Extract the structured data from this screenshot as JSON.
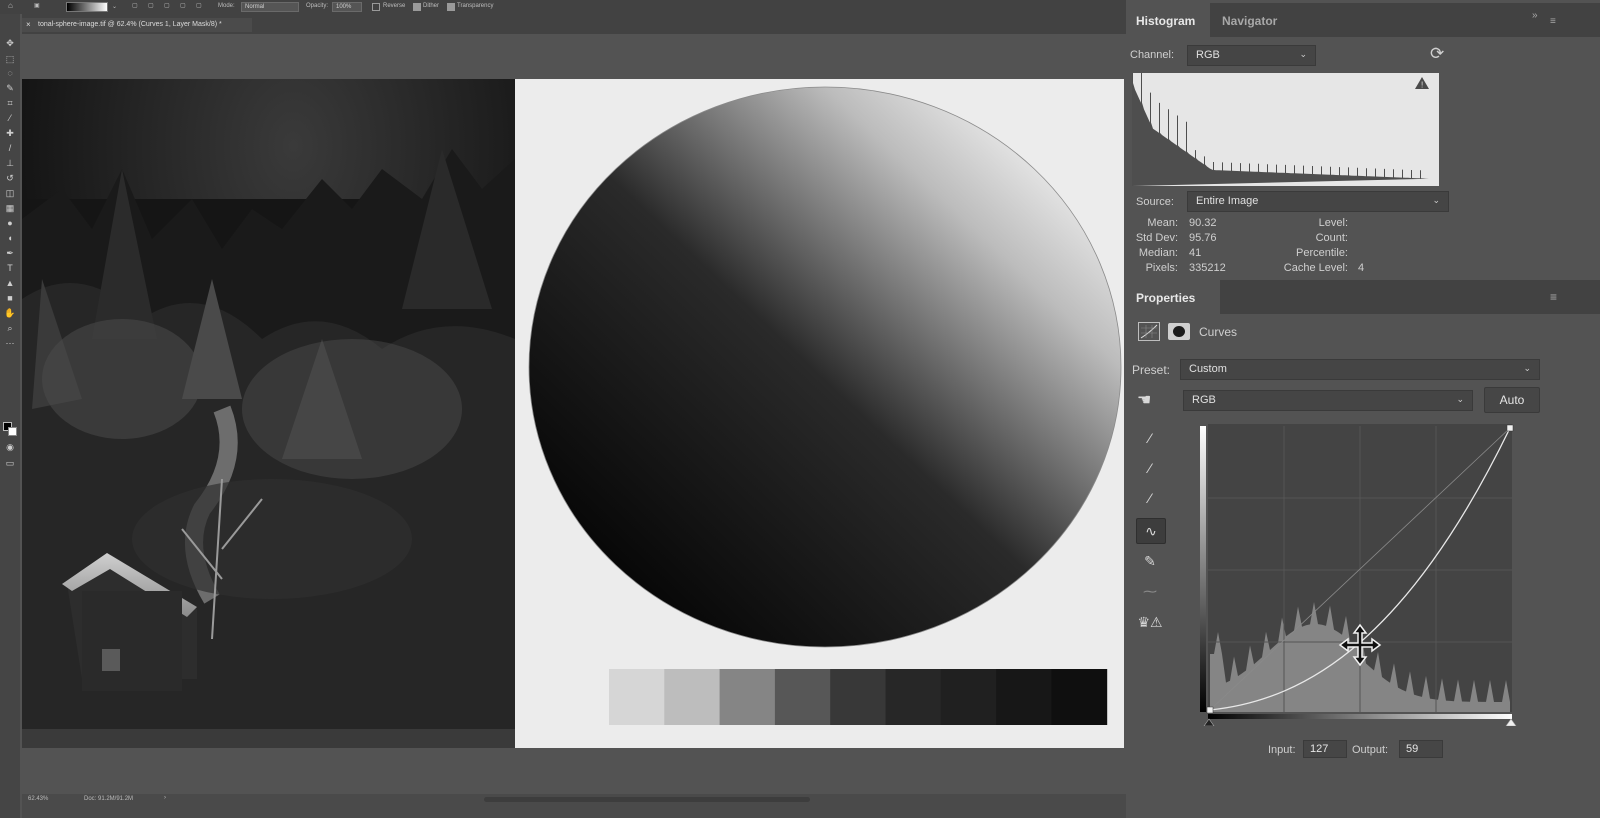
{
  "options_bar": {
    "mode_label": "Mode:",
    "mode_value": "Normal",
    "opacity_label": "Opacity:",
    "opacity_value": "100%",
    "reverse_label": "Reverse",
    "dither_label": "Dither",
    "transparency_label": "Transparency"
  },
  "document": {
    "tab_title": "tonal-sphere-image.tif @ 62.4% (Curves 1, Layer Mask/8) *"
  },
  "status_bar": {
    "zoom": "62.43%",
    "doc_size": "Doc: 91.2M/91.2M"
  },
  "canvas": {
    "tonal_steps": [
      "#d6d6d6",
      "#bdbdbd",
      "#858585",
      "#575757",
      "#383838",
      "#272727",
      "#202020",
      "#171717",
      "#0f0f0f"
    ]
  },
  "histogram_panel": {
    "tabs": [
      {
        "label": "Histogram",
        "active": true
      },
      {
        "label": "Navigator",
        "active": false
      }
    ],
    "channel_label": "Channel:",
    "channel_value": "RGB",
    "source_label": "Source:",
    "source_value": "Entire Image",
    "stats": {
      "mean_label": "Mean:",
      "mean": "90.32",
      "stddev_label": "Std Dev:",
      "stddev": "95.76",
      "median_label": "Median:",
      "median": "41",
      "pixels_label": "Pixels:",
      "pixels": "335212",
      "level_label": "Level:",
      "count_label": "Count:",
      "percentile_label": "Percentile:",
      "cache_label": "Cache Level:",
      "cache": "4"
    }
  },
  "properties_panel": {
    "tab_label": "Properties",
    "adjustment_name": "Curves",
    "preset_label": "Preset:",
    "preset_value": "Custom",
    "channel_value": "RGB",
    "auto_label": "Auto",
    "input_label": "Input:",
    "input_value": "127",
    "output_label": "Output:",
    "output_value": "59"
  },
  "colors": {
    "panel_bg": "#535353",
    "tab_bg": "#424242",
    "canvas_white": "#ececec"
  }
}
